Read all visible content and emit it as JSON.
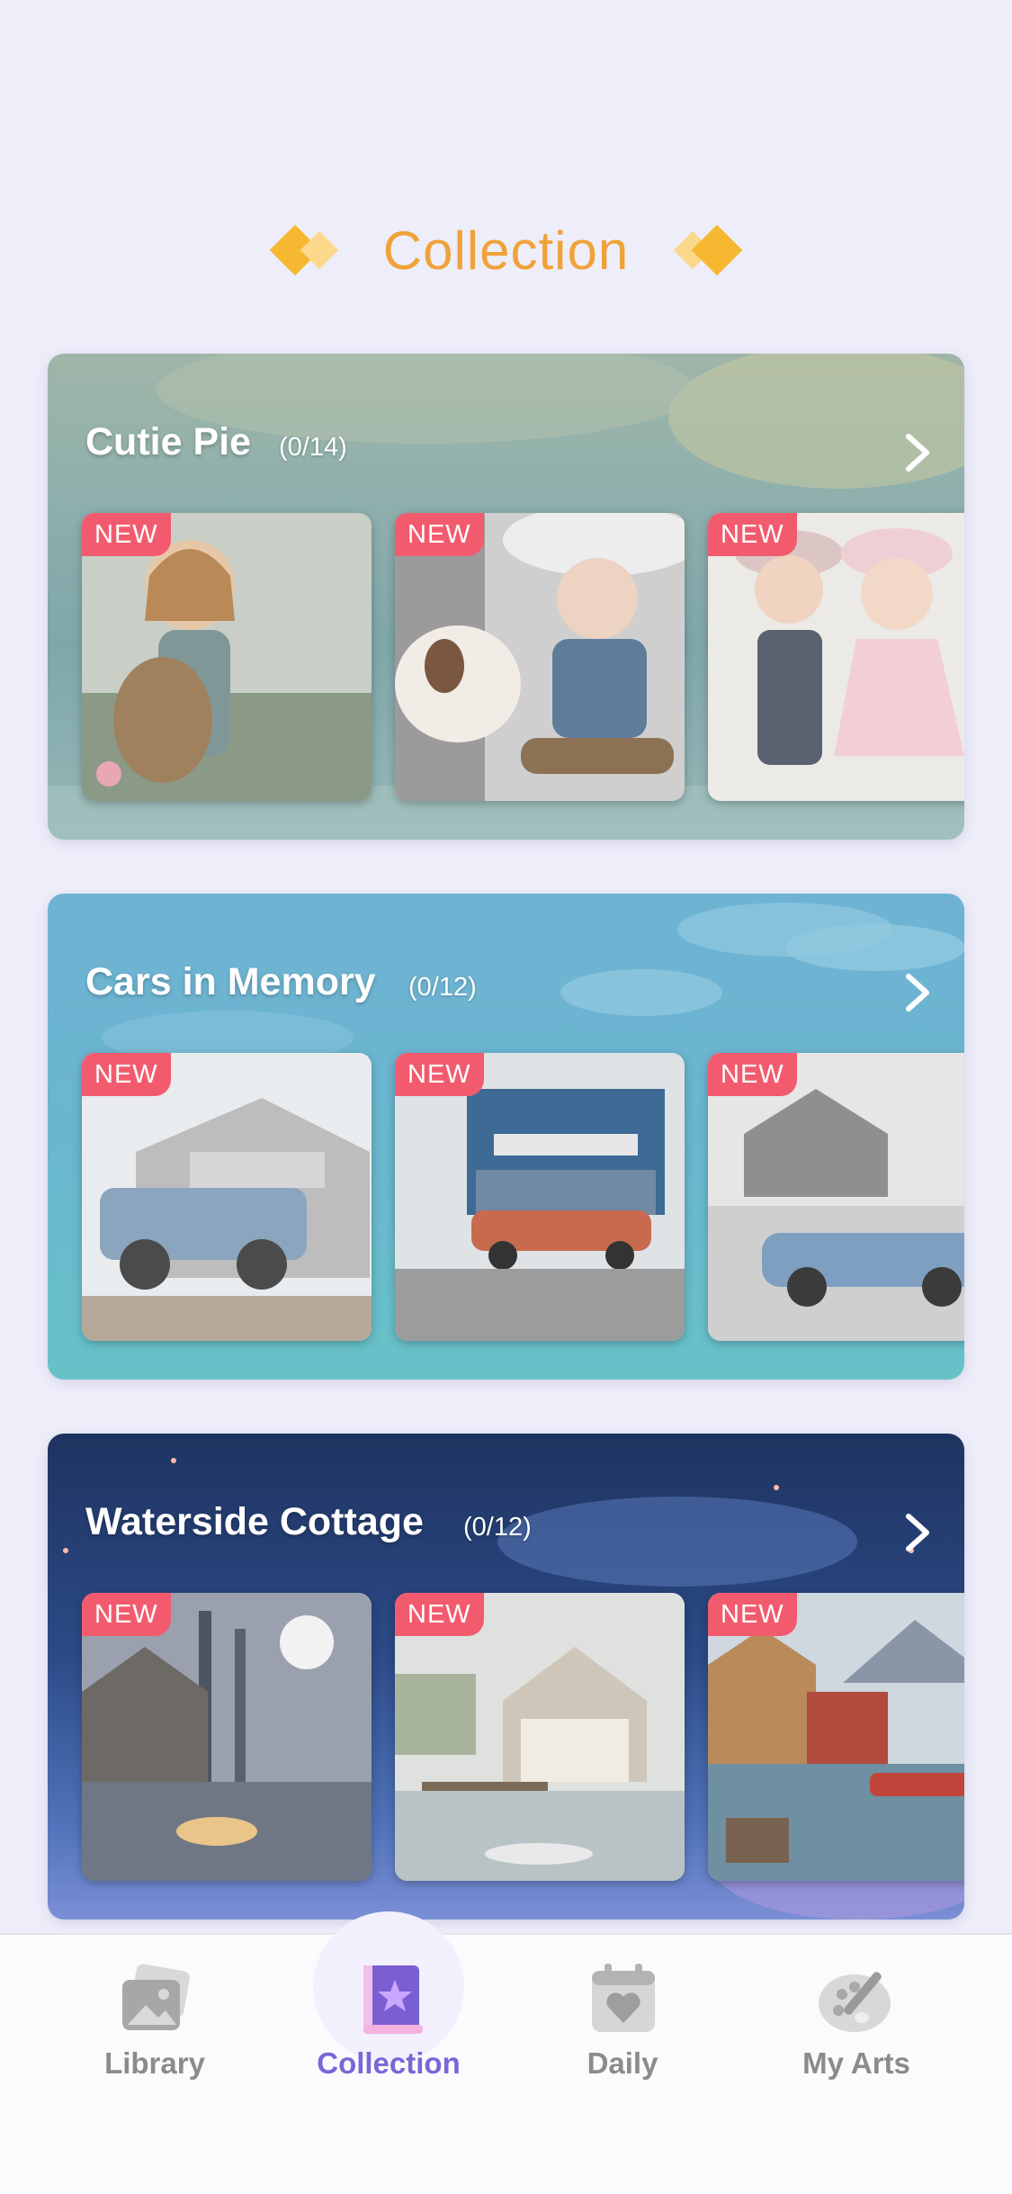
{
  "header": {
    "title": "Collection"
  },
  "collections": [
    {
      "name": "Cutie Pie",
      "count": "(0/14)",
      "badges": [
        "NEW",
        "NEW",
        "NEW"
      ]
    },
    {
      "name": "Cars in Memory",
      "count": "(0/12)",
      "badges": [
        "NEW",
        "NEW",
        "NEW"
      ]
    },
    {
      "name": "Waterside Cottage",
      "count": "(0/12)",
      "badges": [
        "NEW",
        "NEW",
        "NEW"
      ]
    }
  ],
  "nav": {
    "items": [
      {
        "label": "Library",
        "icon": "picture-stack-icon"
      },
      {
        "label": "Collection",
        "icon": "star-book-icon"
      },
      {
        "label": "Daily",
        "icon": "calendar-heart-icon"
      },
      {
        "label": "My Arts",
        "icon": "palette-brush-icon"
      }
    ],
    "active_index": 1
  },
  "colors": {
    "accent_orange": "#f0a23a",
    "new_badge": "#f25b6e",
    "nav_active": "#7a66d6",
    "nav_inactive": "#8b8b8b"
  }
}
